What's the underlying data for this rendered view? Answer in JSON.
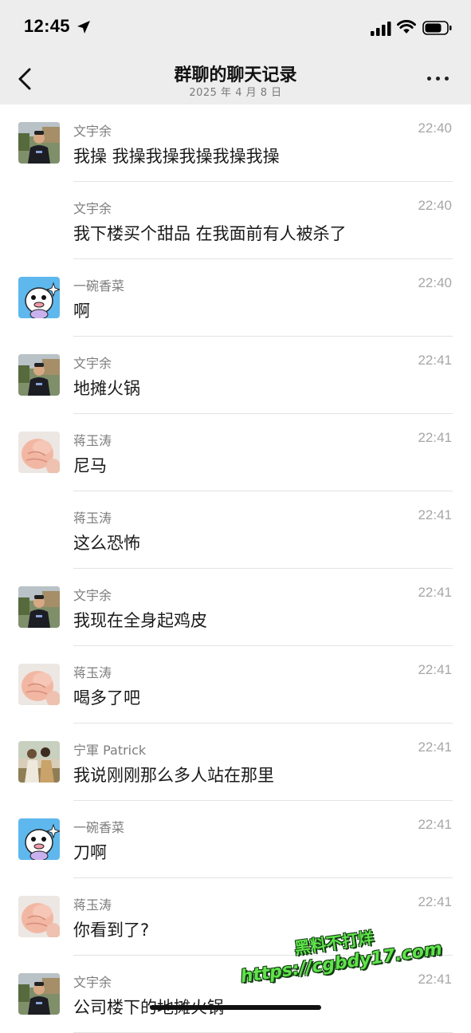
{
  "status_bar": {
    "time": "12:45"
  },
  "header": {
    "title": "群聊的聊天记录",
    "subtitle": "2025 年 4 月 8 日"
  },
  "messages": [
    {
      "sender": "文宇余",
      "time": "22:40",
      "text": "我操 我操我操我操我操我操",
      "avatar": "photo-man"
    },
    {
      "sender": "文宇余",
      "time": "22:40",
      "text": "我下楼买个甜品 在我面前有人被杀了",
      "avatar": "none"
    },
    {
      "sender": "一碗香菜",
      "time": "22:40",
      "text": "啊",
      "avatar": "cartoon"
    },
    {
      "sender": "文宇余",
      "time": "22:41",
      "text": "地摊火锅",
      "avatar": "photo-man"
    },
    {
      "sender": "蒋玉涛",
      "time": "22:41",
      "text": "尼马",
      "avatar": "baby-fist"
    },
    {
      "sender": "蒋玉涛",
      "time": "22:41",
      "text": "这么恐怖",
      "avatar": "none"
    },
    {
      "sender": "文宇余",
      "time": "22:41",
      "text": "我现在全身起鸡皮",
      "avatar": "photo-man"
    },
    {
      "sender": "蒋玉涛",
      "time": "22:41",
      "text": "喝多了吧",
      "avatar": "baby-fist"
    },
    {
      "sender": "宁軍 Patrick",
      "time": "22:41",
      "text": "我说刚刚那么多人站在那里",
      "avatar": "photo-couple"
    },
    {
      "sender": "一碗香菜",
      "time": "22:41",
      "text": "刀啊",
      "avatar": "cartoon"
    },
    {
      "sender": "蒋玉涛",
      "time": "22:41",
      "text": "你看到了?",
      "avatar": "baby-fist"
    },
    {
      "sender": "文宇余",
      "time": "22:41",
      "text": "公司楼下的地摊火锅",
      "avatar": "photo-man"
    }
  ],
  "watermark": {
    "line1": "黑料不打烊",
    "line2": "https://cgbdy17.com"
  },
  "colors": {
    "header_bg": "#ededed",
    "watermark_green": "#5fe34a"
  }
}
